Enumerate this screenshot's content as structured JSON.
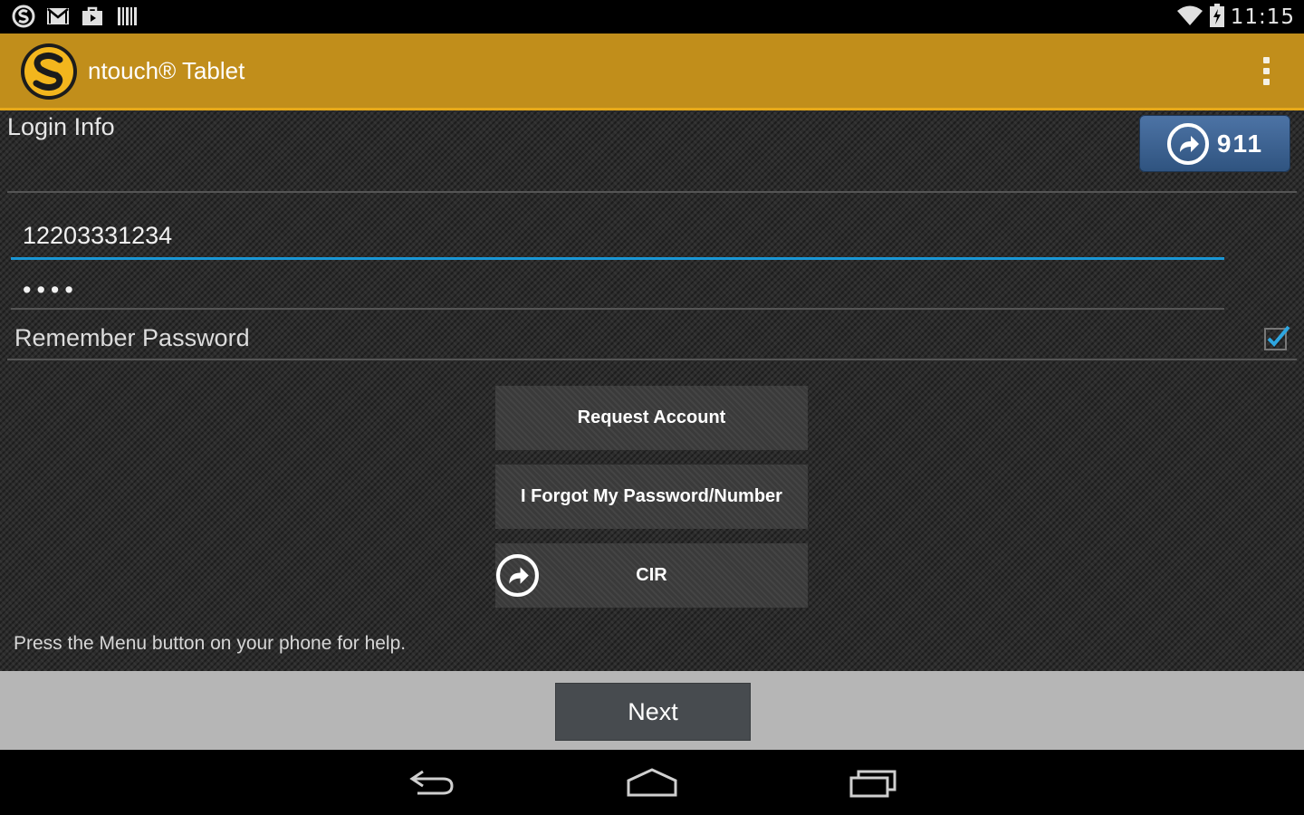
{
  "status_bar": {
    "icons_left": [
      "skype-icon",
      "gmail-icon",
      "store-bag-icon",
      "barcode-icon"
    ],
    "icons_right": [
      "wifi-icon",
      "battery-charging-icon"
    ],
    "time": "11:15"
  },
  "action_bar": {
    "title": "ntouch® Tablet",
    "logo": "sorenson-s-logo",
    "menu_icon": "overflow-menu-icon",
    "colors": {
      "background": "#c18e1b",
      "underline": "#e7a91a"
    }
  },
  "login": {
    "section_title": "Login Info",
    "emergency_button_label": "911",
    "phone_value": "12203331234",
    "password_value": "••••",
    "remember_label": "Remember Password",
    "remember_checked": true
  },
  "buttons": {
    "request_account": "Request Account",
    "forgot": "I Forgot My Password/Number",
    "cir": "CIR"
  },
  "help_text": "Press the Menu button on your phone for help.",
  "footer": {
    "next_label": "Next"
  },
  "nav": {
    "icons": [
      "back-icon",
      "home-icon",
      "recents-icon"
    ]
  }
}
